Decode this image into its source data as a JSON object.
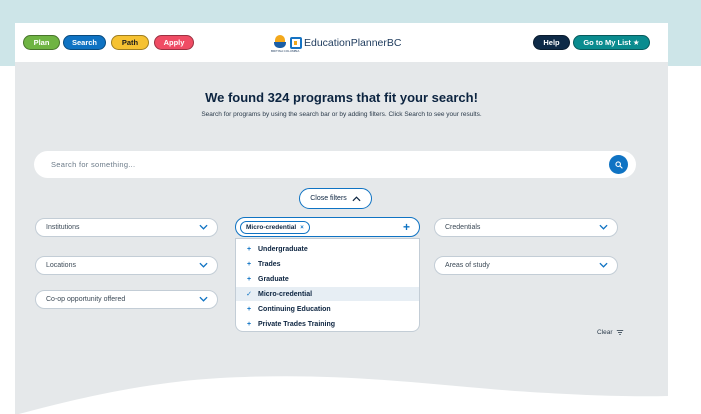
{
  "nav": {
    "plan": "Plan",
    "search": "Search",
    "path": "Path",
    "apply": "Apply",
    "help": "Help",
    "go_to_list": "Go to My List ★"
  },
  "logo": {
    "crest_text": "BRITISH COLUMBIA",
    "name": "EducationPlannerBC"
  },
  "headline": "We found 324 programs that fit your search!",
  "subline": "Search for programs by using the search bar or by adding filters. Click Search to see your results.",
  "search": {
    "placeholder": "Search for something..."
  },
  "close_filters": "Close filters",
  "filters": {
    "institutions": "Institutions",
    "locations": "Locations",
    "coop": "Co-op opportunity offered",
    "credentials": "Credentials",
    "areas": "Areas of study"
  },
  "program_type": {
    "selected_chip": "Micro-credential",
    "chip_remove": "×",
    "options": [
      {
        "label": "Undergraduate",
        "icon": "+"
      },
      {
        "label": "Trades",
        "icon": "+"
      },
      {
        "label": "Graduate",
        "icon": "+"
      },
      {
        "label": "Micro-credential",
        "icon": "✓"
      },
      {
        "label": "Continuing Education",
        "icon": "+"
      },
      {
        "label": "Private Trades Training",
        "icon": "+"
      }
    ]
  },
  "clear": "Clear",
  "colors": {
    "plan": "#6fb443",
    "search": "#0f73c3",
    "path": "#f6c232",
    "apply": "#ef4c64",
    "help": "#0e2a47",
    "go_to_list": "#0a8c8f",
    "accent": "#0f73c3",
    "page_bg": "#e5e8ea"
  },
  "icons": {
    "search": "magnifier-icon",
    "chevron": "chevron-down-icon",
    "chevron_up": "chevron-up-icon",
    "clear": "filter-clear-icon"
  }
}
